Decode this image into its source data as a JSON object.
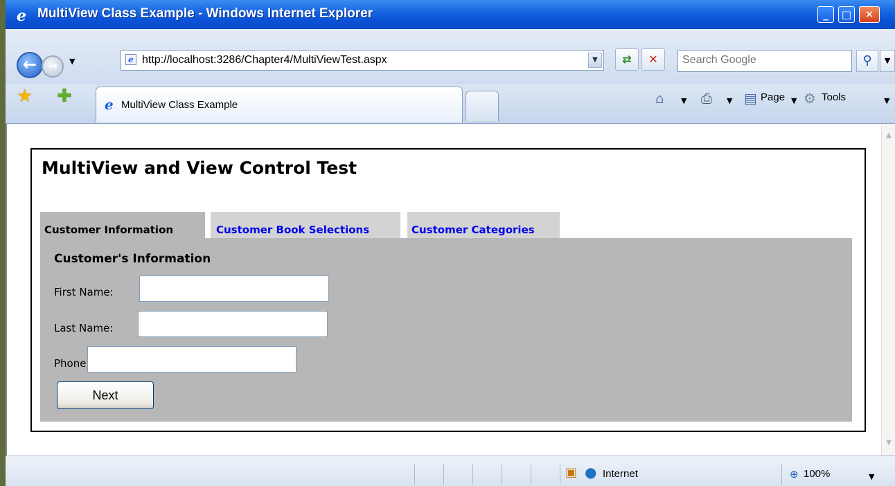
{
  "window": {
    "title": "MultiView Class Example - Windows Internet Explorer",
    "minimize": "_",
    "maximize": "□",
    "close": "✕"
  },
  "navbar": {
    "address_url": "http://localhost:3286/Chapter4/MultiViewTest.aspx",
    "search_placeholder": "Search Google"
  },
  "commandbar": {
    "tab_title": "MultiView Class Example",
    "page_label": "Page",
    "tools_label": "Tools"
  },
  "page": {
    "heading": "MultiView and View Control Test",
    "tabs": [
      {
        "label": "Customer Information",
        "active": true
      },
      {
        "label": "Customer Book Selections",
        "active": false
      },
      {
        "label": "Customer Categories",
        "active": false
      }
    ],
    "section_title": "Customer's Information",
    "fields": {
      "first_name_label": "First Name:",
      "last_name_label": "Last Name:",
      "phone_label": "Phone:",
      "first_name_value": "",
      "last_name_value": "",
      "phone_value": ""
    },
    "next_button": "Next"
  },
  "statusbar": {
    "zone": "Internet",
    "zoom": "100%"
  },
  "icons": [
    "ie-logo-icon",
    "back-icon",
    "forward-icon",
    "page-icon",
    "refresh-icon",
    "stop-icon",
    "search-icon",
    "favorites-star-icon",
    "add-favorites-icon",
    "home-icon",
    "print-icon",
    "page-menu-icon",
    "tools-gear-icon",
    "protected-mode-icon",
    "globe-icon",
    "zoom-icon"
  ]
}
